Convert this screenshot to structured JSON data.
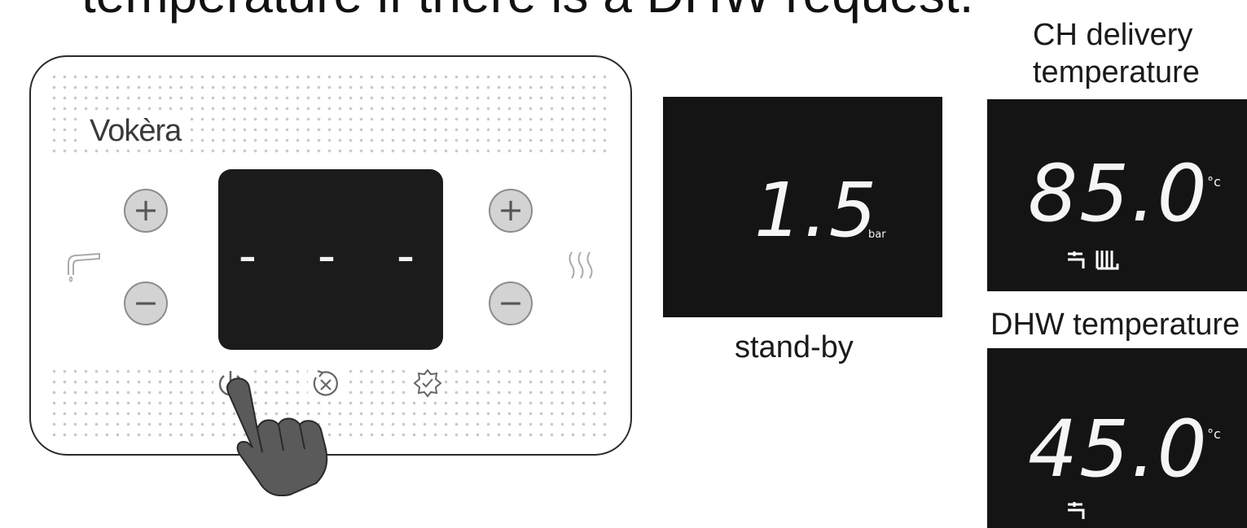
{
  "header": {
    "partial_text": "temperature if there is a DHW request."
  },
  "panel": {
    "brand": "Vokèra",
    "display_value": "- - -",
    "buttons": {
      "dhw_plus": "+",
      "dhw_minus": "−",
      "ch_plus": "+",
      "ch_minus": "−"
    },
    "icons": [
      "tap-icon",
      "radiator-heat-icon",
      "power-icon",
      "reset-icon",
      "settings-icon",
      "pointing-hand-icon"
    ]
  },
  "standby": {
    "value": "1.5",
    "unit": "bar",
    "label": "stand-by"
  },
  "ch_delivery": {
    "label_line1": "CH delivery",
    "label_line2": "temperature",
    "value": "85.0",
    "unit": "°c"
  },
  "dhw": {
    "label": "DHW temperature",
    "value": "45.0",
    "unit": "°c"
  },
  "colors": {
    "display_bg": "#141414",
    "display_text": "#f5f5f5",
    "button_fill": "#d3d3d3"
  }
}
